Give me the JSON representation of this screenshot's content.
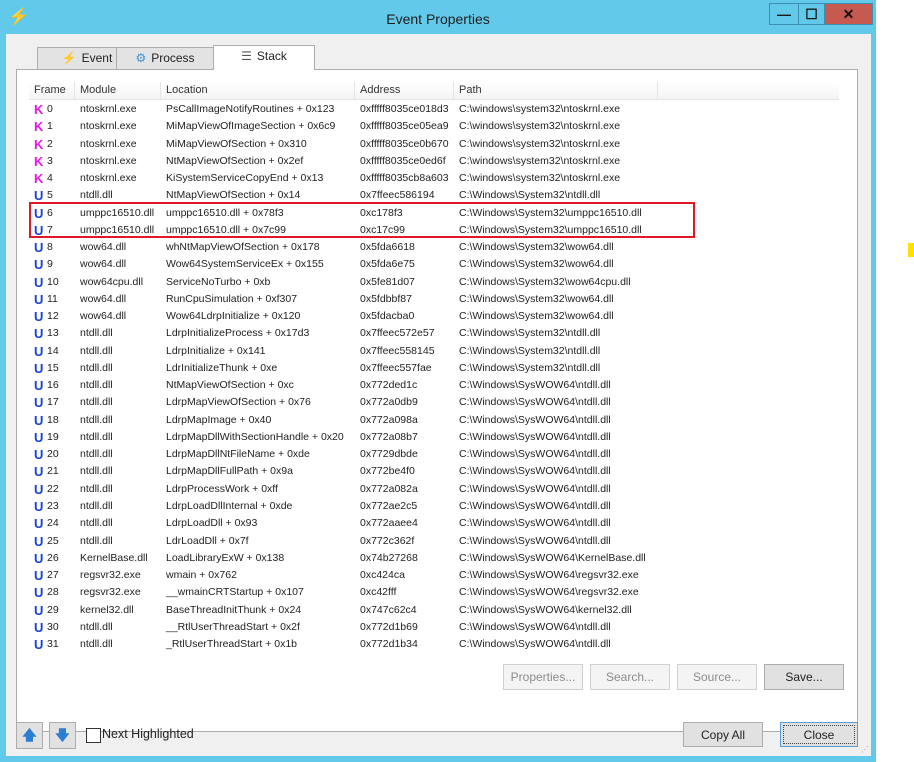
{
  "window": {
    "title": "Event Properties",
    "minimize": "—",
    "maximize": "☐",
    "close": "✕"
  },
  "tabs": [
    {
      "label": "Event",
      "icon": "lightning-icon",
      "glyph": "⚡"
    },
    {
      "label": "Process",
      "icon": "gear-icon",
      "glyph": "⚙"
    },
    {
      "label": "Stack",
      "icon": "stack-icon",
      "glyph": "☰"
    }
  ],
  "columns": [
    "Frame",
    "Module",
    "Location",
    "Address",
    "Path"
  ],
  "colors": {
    "kernel": "#e815e8",
    "user": "#1540e0",
    "highlight_box": "#e0192a",
    "titlebar": "#62c9ea"
  },
  "frames": [
    {
      "mode": "K",
      "frame": "0",
      "module": "ntoskrnl.exe",
      "location": "PsCallImageNotifyRoutines + 0x123",
      "address": "0xfffff8035ce018d3",
      "path": "C:\\windows\\system32\\ntoskrnl.exe"
    },
    {
      "mode": "K",
      "frame": "1",
      "module": "ntoskrnl.exe",
      "location": "MiMapViewOfImageSection + 0x6c9",
      "address": "0xfffff8035ce05ea9",
      "path": "C:\\windows\\system32\\ntoskrnl.exe"
    },
    {
      "mode": "K",
      "frame": "2",
      "module": "ntoskrnl.exe",
      "location": "MiMapViewOfSection + 0x310",
      "address": "0xfffff8035ce0b670",
      "path": "C:\\windows\\system32\\ntoskrnl.exe"
    },
    {
      "mode": "K",
      "frame": "3",
      "module": "ntoskrnl.exe",
      "location": "NtMapViewOfSection + 0x2ef",
      "address": "0xfffff8035ce0ed6f",
      "path": "C:\\windows\\system32\\ntoskrnl.exe"
    },
    {
      "mode": "K",
      "frame": "4",
      "module": "ntoskrnl.exe",
      "location": "KiSystemServiceCopyEnd + 0x13",
      "address": "0xfffff8035cb8a603",
      "path": "C:\\windows\\system32\\ntoskrnl.exe"
    },
    {
      "mode": "U",
      "frame": "5",
      "module": "ntdll.dll",
      "location": "NtMapViewOfSection + 0x14",
      "address": "0x7ffeec586194",
      "path": "C:\\Windows\\System32\\ntdll.dll"
    },
    {
      "mode": "U",
      "frame": "6",
      "module": "umppc16510.dll",
      "location": "umppc16510.dll + 0x78f3",
      "address": "0xc178f3",
      "path": "C:\\Windows\\System32\\umppc16510.dll"
    },
    {
      "mode": "U",
      "frame": "7",
      "module": "umppc16510.dll",
      "location": "umppc16510.dll + 0x7c99",
      "address": "0xc17c99",
      "path": "C:\\Windows\\System32\\umppc16510.dll"
    },
    {
      "mode": "U",
      "frame": "8",
      "module": "wow64.dll",
      "location": "whNtMapViewOfSection + 0x178",
      "address": "0x5fda6618",
      "path": "C:\\Windows\\System32\\wow64.dll"
    },
    {
      "mode": "U",
      "frame": "9",
      "module": "wow64.dll",
      "location": "Wow64SystemServiceEx + 0x155",
      "address": "0x5fda6e75",
      "path": "C:\\Windows\\System32\\wow64.dll"
    },
    {
      "mode": "U",
      "frame": "10",
      "module": "wow64cpu.dll",
      "location": "ServiceNoTurbo + 0xb",
      "address": "0x5fe81d07",
      "path": "C:\\Windows\\System32\\wow64cpu.dll"
    },
    {
      "mode": "U",
      "frame": "11",
      "module": "wow64.dll",
      "location": "RunCpuSimulation + 0xf307",
      "address": "0x5fdbbf87",
      "path": "C:\\Windows\\System32\\wow64.dll"
    },
    {
      "mode": "U",
      "frame": "12",
      "module": "wow64.dll",
      "location": "Wow64LdrpInitialize + 0x120",
      "address": "0x5fdacba0",
      "path": "C:\\Windows\\System32\\wow64.dll"
    },
    {
      "mode": "U",
      "frame": "13",
      "module": "ntdll.dll",
      "location": "LdrpInitializeProcess + 0x17d3",
      "address": "0x7ffeec572e57",
      "path": "C:\\Windows\\System32\\ntdll.dll"
    },
    {
      "mode": "U",
      "frame": "14",
      "module": "ntdll.dll",
      "location": "LdrpInitialize + 0x141",
      "address": "0x7ffeec558145",
      "path": "C:\\Windows\\System32\\ntdll.dll"
    },
    {
      "mode": "U",
      "frame": "15",
      "module": "ntdll.dll",
      "location": "LdrInitializeThunk + 0xe",
      "address": "0x7ffeec557fae",
      "path": "C:\\Windows\\System32\\ntdll.dll"
    },
    {
      "mode": "U",
      "frame": "16",
      "module": "ntdll.dll",
      "location": "NtMapViewOfSection + 0xc",
      "address": "0x772ded1c",
      "path": "C:\\Windows\\SysWOW64\\ntdll.dll"
    },
    {
      "mode": "U",
      "frame": "17",
      "module": "ntdll.dll",
      "location": "LdrpMapViewOfSection + 0x76",
      "address": "0x772a0db9",
      "path": "C:\\Windows\\SysWOW64\\ntdll.dll"
    },
    {
      "mode": "U",
      "frame": "18",
      "module": "ntdll.dll",
      "location": "LdrpMapImage + 0x40",
      "address": "0x772a098a",
      "path": "C:\\Windows\\SysWOW64\\ntdll.dll"
    },
    {
      "mode": "U",
      "frame": "19",
      "module": "ntdll.dll",
      "location": "LdrpMapDllWithSectionHandle + 0x20",
      "address": "0x772a08b7",
      "path": "C:\\Windows\\SysWOW64\\ntdll.dll"
    },
    {
      "mode": "U",
      "frame": "20",
      "module": "ntdll.dll",
      "location": "LdrpMapDllNtFileName + 0xde",
      "address": "0x7729dbde",
      "path": "C:\\Windows\\SysWOW64\\ntdll.dll"
    },
    {
      "mode": "U",
      "frame": "21",
      "module": "ntdll.dll",
      "location": "LdrpMapDllFullPath + 0x9a",
      "address": "0x772be4f0",
      "path": "C:\\Windows\\SysWOW64\\ntdll.dll"
    },
    {
      "mode": "U",
      "frame": "22",
      "module": "ntdll.dll",
      "location": "LdrpProcessWork + 0xff",
      "address": "0x772a082a",
      "path": "C:\\Windows\\SysWOW64\\ntdll.dll"
    },
    {
      "mode": "U",
      "frame": "23",
      "module": "ntdll.dll",
      "location": "LdrpLoadDllInternal + 0xde",
      "address": "0x772ae2c5",
      "path": "C:\\Windows\\SysWOW64\\ntdll.dll"
    },
    {
      "mode": "U",
      "frame": "24",
      "module": "ntdll.dll",
      "location": "LdrpLoadDll + 0x93",
      "address": "0x772aaee4",
      "path": "C:\\Windows\\SysWOW64\\ntdll.dll"
    },
    {
      "mode": "U",
      "frame": "25",
      "module": "ntdll.dll",
      "location": "LdrLoadDll + 0x7f",
      "address": "0x772c362f",
      "path": "C:\\Windows\\SysWOW64\\ntdll.dll"
    },
    {
      "mode": "U",
      "frame": "26",
      "module": "KernelBase.dll",
      "location": "LoadLibraryExW + 0x138",
      "address": "0x74b27268",
      "path": "C:\\Windows\\SysWOW64\\KernelBase.dll"
    },
    {
      "mode": "U",
      "frame": "27",
      "module": "regsvr32.exe",
      "location": "wmain + 0x762",
      "address": "0xc424ca",
      "path": "C:\\Windows\\SysWOW64\\regsvr32.exe"
    },
    {
      "mode": "U",
      "frame": "28",
      "module": "regsvr32.exe",
      "location": "__wmainCRTStartup + 0x107",
      "address": "0xc42fff",
      "path": "C:\\Windows\\SysWOW64\\regsvr32.exe"
    },
    {
      "mode": "U",
      "frame": "29",
      "module": "kernel32.dll",
      "location": "BaseThreadInitThunk + 0x24",
      "address": "0x747c62c4",
      "path": "C:\\Windows\\SysWOW64\\kernel32.dll"
    },
    {
      "mode": "U",
      "frame": "30",
      "module": "ntdll.dll",
      "location": "__RtlUserThreadStart + 0x2f",
      "address": "0x772d1b69",
      "path": "C:\\Windows\\SysWOW64\\ntdll.dll"
    },
    {
      "mode": "U",
      "frame": "31",
      "module": "ntdll.dll",
      "location": "_RtlUserThreadStart + 0x1b",
      "address": "0x772d1b34",
      "path": "C:\\Windows\\SysWOW64\\ntdll.dll"
    }
  ],
  "panel_buttons": {
    "properties": "Properties...",
    "search": "Search...",
    "source": "Source...",
    "save": "Save..."
  },
  "footer": {
    "up": "🡅",
    "down": "🡇",
    "next_highlighted": "Next Highlighted",
    "next_highlighted_checked": false,
    "copy_all": "Copy All",
    "close": "Close"
  }
}
